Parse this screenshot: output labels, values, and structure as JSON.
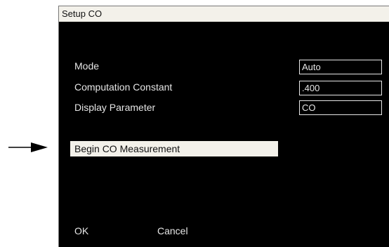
{
  "dialog": {
    "title": "Setup CO"
  },
  "params": [
    {
      "label": "Mode",
      "value": "Auto"
    },
    {
      "label": "Computation Constant",
      "value": ".400"
    },
    {
      "label": "Display Parameter",
      "value": "CO"
    }
  ],
  "actions": {
    "begin_label": "Begin CO Measurement",
    "ok_label": "OK",
    "cancel_label": "Cancel"
  },
  "icons": {
    "pointer": "arrow-right-icon"
  }
}
